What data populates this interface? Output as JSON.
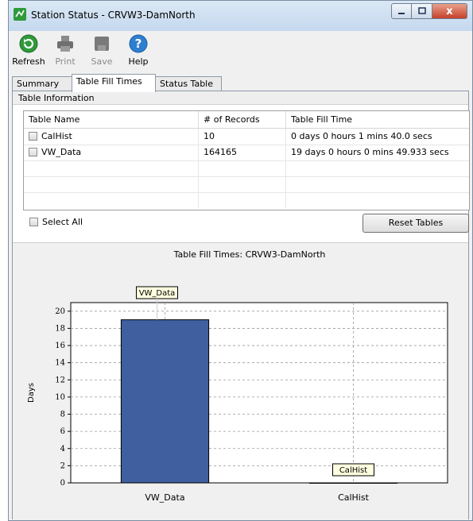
{
  "window": {
    "title": "Station Status - CRVW3-DamNorth",
    "close_glyph": "x"
  },
  "toolbar": {
    "refresh": {
      "label": "Refresh",
      "icon": "refresh-icon"
    },
    "print": {
      "label": "Print",
      "icon": "printer-icon"
    },
    "save": {
      "label": "Save",
      "icon": "save-icon"
    },
    "help": {
      "label": "Help",
      "icon": "help-icon",
      "glyph": "?"
    }
  },
  "tabs": [
    {
      "label": "Summary",
      "active": false
    },
    {
      "label": "Table Fill Times",
      "active": true
    },
    {
      "label": "Status Table",
      "active": false
    }
  ],
  "table_info": {
    "header": "Table Information",
    "columns": [
      "Table Name",
      "# of Records",
      "Table Fill Time"
    ],
    "rows": [
      {
        "name": "CalHist",
        "records": "10",
        "fill_time": "0 days 0 hours 1 mins 40.0 secs"
      },
      {
        "name": "VW_Data",
        "records": "164165",
        "fill_time": "19 days 0 hours 0 mins 49.933 secs"
      }
    ],
    "select_all_label": "Select All",
    "reset_button": "Reset Tables"
  },
  "chart_data": {
    "type": "bar",
    "title": "Table Fill Times: CRVW3-DamNorth",
    "categories": [
      "VW_Data",
      "CalHist"
    ],
    "values": [
      19.0,
      0.0012
    ],
    "bar_tooltips": [
      "VW_Data",
      "CalHist"
    ],
    "ylabel": "Days",
    "xlabel": "",
    "ylim": [
      0,
      21
    ],
    "yticks": [
      0,
      2,
      4,
      6,
      8,
      10,
      12,
      14,
      16,
      18,
      20
    ],
    "grid": true,
    "bar_color": "#3f5f9f"
  },
  "colors": {
    "titlebar": "#c4d8ee",
    "close_button": "#c7402a",
    "bar": "#3f5f9f",
    "tooltip_bg": "#ffffe0"
  }
}
